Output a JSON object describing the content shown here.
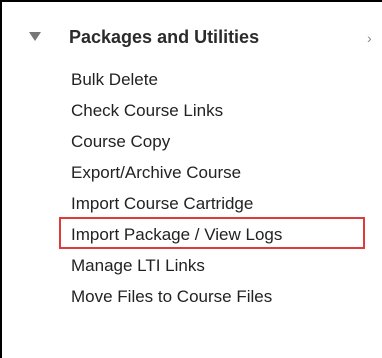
{
  "section": {
    "title": "Packages and Utilities",
    "expanded_icon": "triangle-down-icon",
    "more_icon": "chevron-right-icon",
    "more_glyph": "›"
  },
  "menu": {
    "items": [
      {
        "label": "Bulk Delete"
      },
      {
        "label": "Check Course Links"
      },
      {
        "label": "Course Copy"
      },
      {
        "label": "Export/Archive Course"
      },
      {
        "label": "Import Course Cartridge"
      },
      {
        "label": "Import Package / View Logs",
        "highlighted": true
      },
      {
        "label": "Manage LTI Links"
      },
      {
        "label": "Move Files to Course Files"
      }
    ]
  },
  "colors": {
    "highlight_border": "#e03b3b",
    "text": "#222222",
    "triangle": "#777777"
  }
}
